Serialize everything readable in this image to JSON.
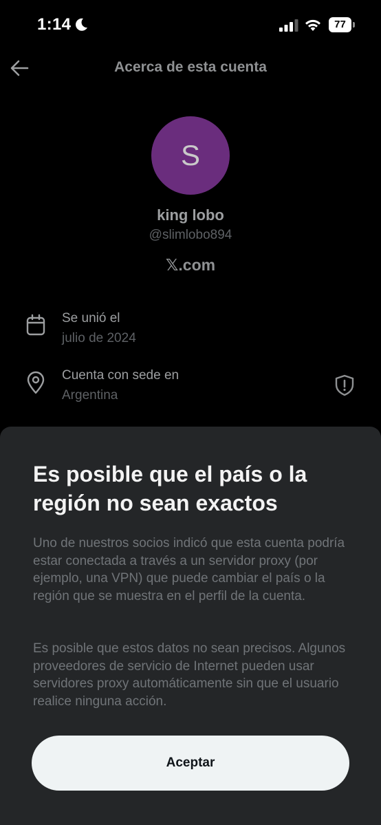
{
  "status_bar": {
    "time": "1:14",
    "battery": "77"
  },
  "header": {
    "title": "Acerca de esta cuenta"
  },
  "profile": {
    "avatar_letter": "S",
    "avatar_color": "#6a2d7d",
    "display_name": "king lobo",
    "handle": "@slimlobo894",
    "domain": "𝕏.com"
  },
  "info": {
    "joined_label": "Se unió el",
    "joined_value": "julio de 2024",
    "location_label": "Cuenta con sede en",
    "location_value": "Argentina"
  },
  "sheet": {
    "title": "Es posible que el país o la región no sean exactos",
    "paragraph_1": "Uno de nuestros socios indicó que esta cuenta podría estar conectada a través a un servidor proxy (por ejemplo, una VPN) que puede cambiar el país o la región que se muestra en el perfil de la cuenta.",
    "paragraph_2": "Es posible que estos datos no sean precisos. Algunos proveedores de servicio de Internet pueden usar servidores proxy automáticamente sin que el usuario realice ninguna acción.",
    "accept_label": "Aceptar"
  },
  "icons": {
    "moon": "moon-icon",
    "signal": "cellular-signal-icon",
    "wifi": "wifi-icon",
    "back": "back-arrow-icon",
    "calendar": "calendar-icon",
    "location": "location-pin-icon",
    "shield": "shield-alert-icon"
  }
}
